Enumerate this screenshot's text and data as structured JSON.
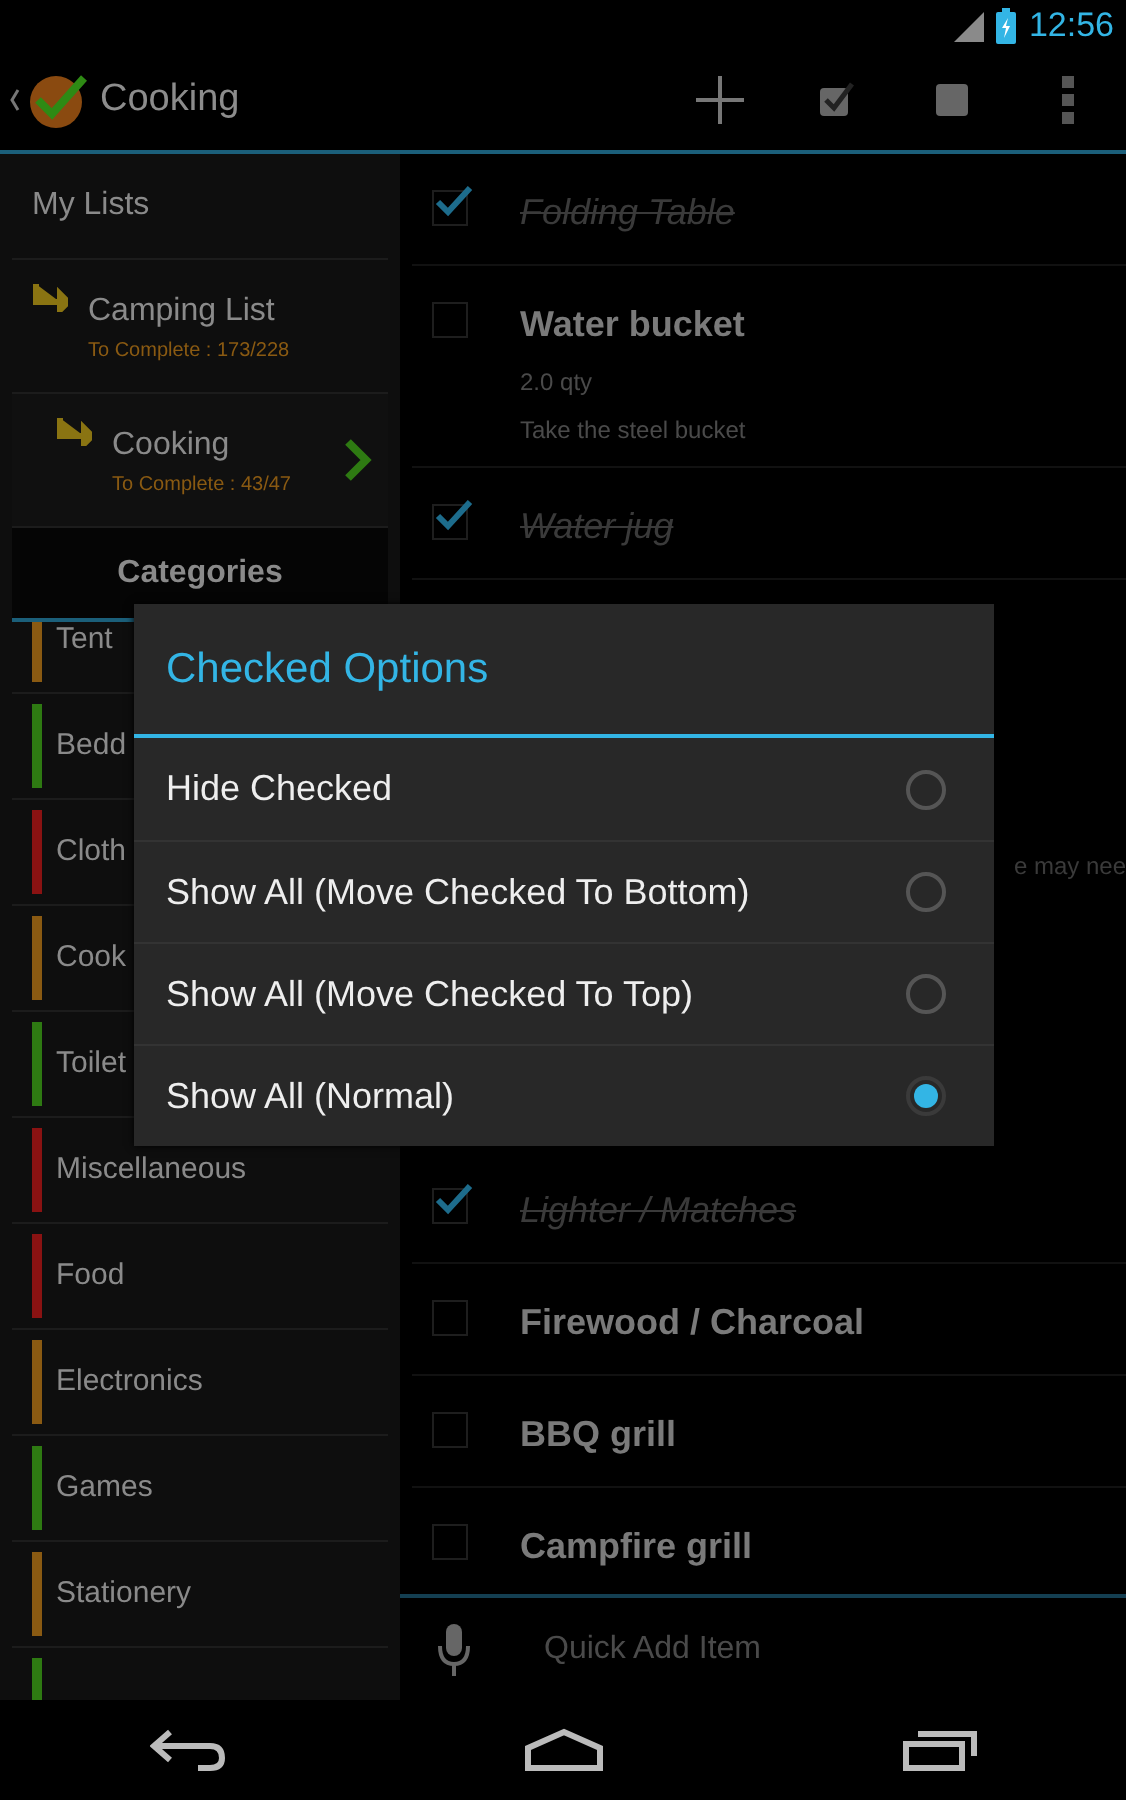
{
  "status_bar": {
    "time": "12:56"
  },
  "action_bar": {
    "title": "Cooking"
  },
  "sidebar": {
    "lists_header": "My Lists",
    "lists": [
      {
        "name": "Camping List",
        "progress": "To Complete : 173/228",
        "selected": false,
        "children": [
          {
            "name": "Cooking",
            "progress": "To Complete : 43/47",
            "selected": true
          }
        ]
      }
    ],
    "categories_header": "Categories",
    "categories": [
      {
        "name": "Tent",
        "color": "#8a5a12"
      },
      {
        "name": "Bedd",
        "color": "#2e7a12"
      },
      {
        "name": "Cloth",
        "color": "#8a1212"
      },
      {
        "name": "Cook",
        "color": "#8a5a12"
      },
      {
        "name": "Toilet",
        "color": "#2e7a12"
      },
      {
        "name": "Miscellaneous",
        "color": "#8a1212"
      },
      {
        "name": "Food",
        "color": "#8a1212"
      },
      {
        "name": "Electronics",
        "color": "#8a5a12"
      },
      {
        "name": "Games",
        "color": "#2e7a12"
      },
      {
        "name": "Stationery",
        "color": "#8a5a12"
      },
      {
        "color": "#2e7a12"
      }
    ]
  },
  "items": [
    {
      "kind": "item",
      "name": "Folding Table",
      "checked": true
    },
    {
      "kind": "item",
      "name": "Water bucket",
      "checked": false,
      "details": [
        "2.0 qty",
        "Take the steel bucket"
      ]
    },
    {
      "kind": "item",
      "name": "Water jug",
      "checked": true
    },
    {
      "kind": "fragment",
      "note": "e may nee"
    },
    {
      "kind": "item",
      "name": "Lighter / Matches",
      "checked": true
    },
    {
      "kind": "item",
      "name": "Firewood / Charcoal",
      "checked": false
    },
    {
      "kind": "item",
      "name": "BBQ grill",
      "checked": false
    },
    {
      "kind": "item",
      "name": "Campfire grill",
      "checked": false
    }
  ],
  "quick_add": {
    "placeholder": "Quick Add Item"
  },
  "dialog": {
    "title": "Checked Options",
    "options": [
      {
        "label": "Hide Checked",
        "selected": false
      },
      {
        "label": "Show All (Move Checked To Bottom)",
        "selected": false
      },
      {
        "label": "Show All (Move Checked To Top)",
        "selected": false
      },
      {
        "label": "Show All (Normal)",
        "selected": true
      }
    ]
  }
}
